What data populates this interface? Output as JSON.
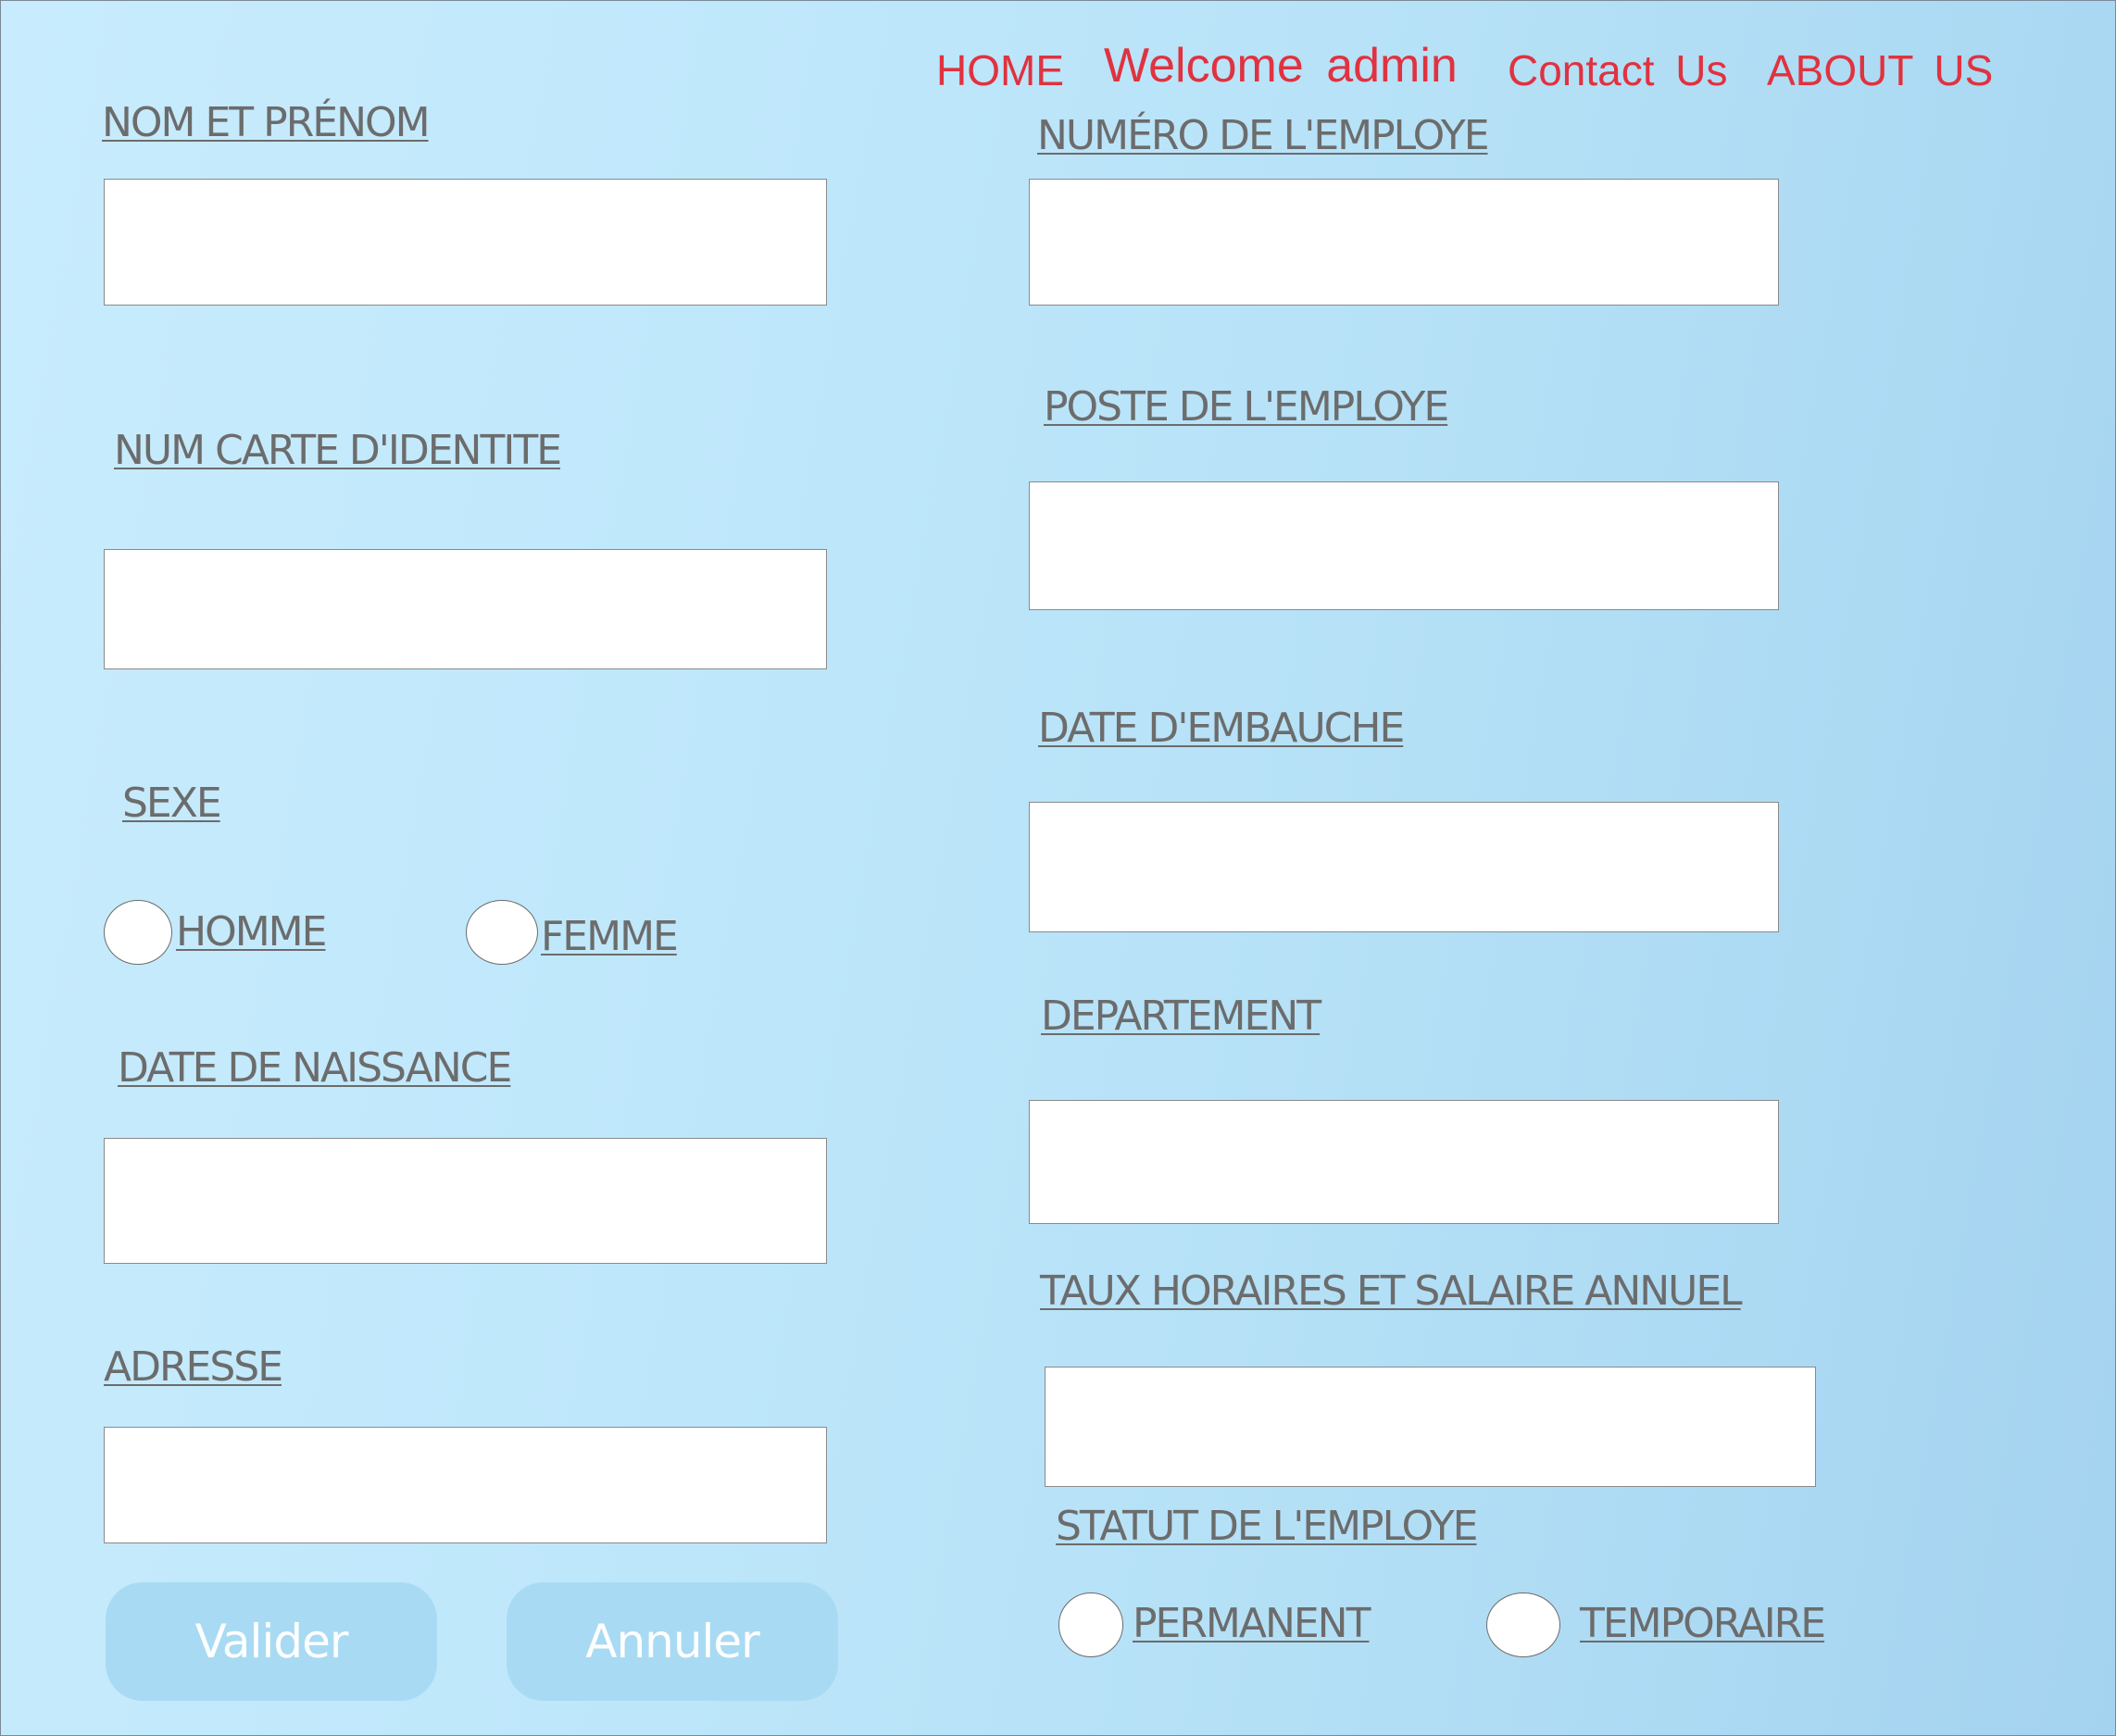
{
  "nav": {
    "home": "HOME",
    "welcome": "Welcome admin",
    "contact": "Contact Us",
    "about": "ABOUT US"
  },
  "form": {
    "nom_prenom": {
      "label": "NOM ET PRÉNOM",
      "value": ""
    },
    "num_carte": {
      "label": "NUM CARTE D'IDENTITE",
      "value": ""
    },
    "sexe": {
      "label": "SEXE",
      "options": [
        "HOMME",
        "FEMME"
      ]
    },
    "date_naissance": {
      "label": "DATE DE NAISSANCE",
      "value": ""
    },
    "adresse": {
      "label": "ADRESSE",
      "value": ""
    },
    "numero_employe": {
      "label": "NUMÉRO DE L'EMPLOYE",
      "value": ""
    },
    "poste_employe": {
      "label": "POSTE DE L'EMPLOYE",
      "value": ""
    },
    "date_embauche": {
      "label": "DATE D'EMBAUCHE",
      "value": ""
    },
    "departement": {
      "label": "DEPARTEMENT",
      "value": ""
    },
    "taux_salaire": {
      "label": "TAUX HORAIRES ET SALAIRE ANNUEL",
      "value": ""
    },
    "statut": {
      "label": "STATUT DE L'EMPLOYE",
      "options": [
        "PERMANENT",
        "TEMPORAIRE"
      ]
    }
  },
  "buttons": {
    "valider": "Valider",
    "annuler": "Annuler"
  },
  "colors": {
    "nav_link": "#e0323f",
    "label": "#6c6c6c",
    "button_bg": "#a8dbf3",
    "background": "#bfe7fb"
  }
}
